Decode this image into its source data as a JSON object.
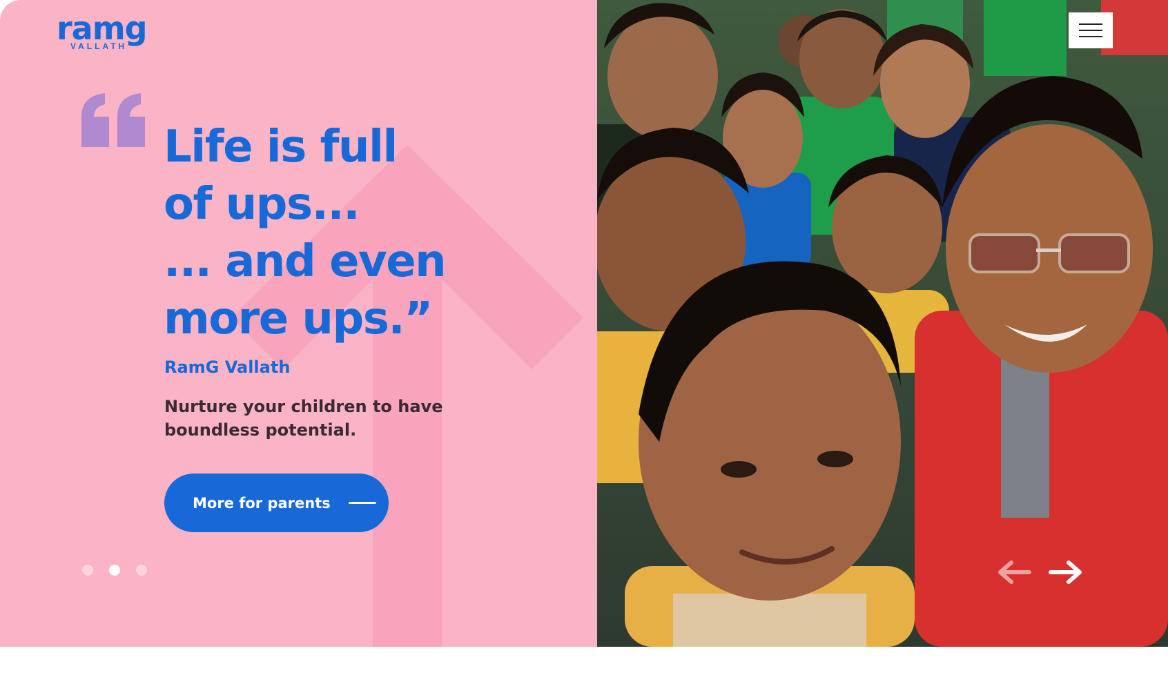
{
  "brand": {
    "name": "ramg",
    "tagline": "VALLATH",
    "accent_color": "#1669d7",
    "panel_color": "#fbb3c6"
  },
  "hero": {
    "headline_lines": [
      "Life is full",
      "of ups...",
      "... and even",
      "more ups.”"
    ],
    "author": "RamG Vallath",
    "subtext": "Nurture your children to have boundless potential.",
    "cta_label": "More for parents"
  },
  "carousel": {
    "slide_count": 3,
    "active_index": 1
  },
  "icons": {
    "quote": "quote-icon",
    "menu": "hamburger-menu-icon",
    "prev": "arrow-left-icon",
    "next": "arrow-right-icon",
    "cta": "dash-line-icon"
  }
}
